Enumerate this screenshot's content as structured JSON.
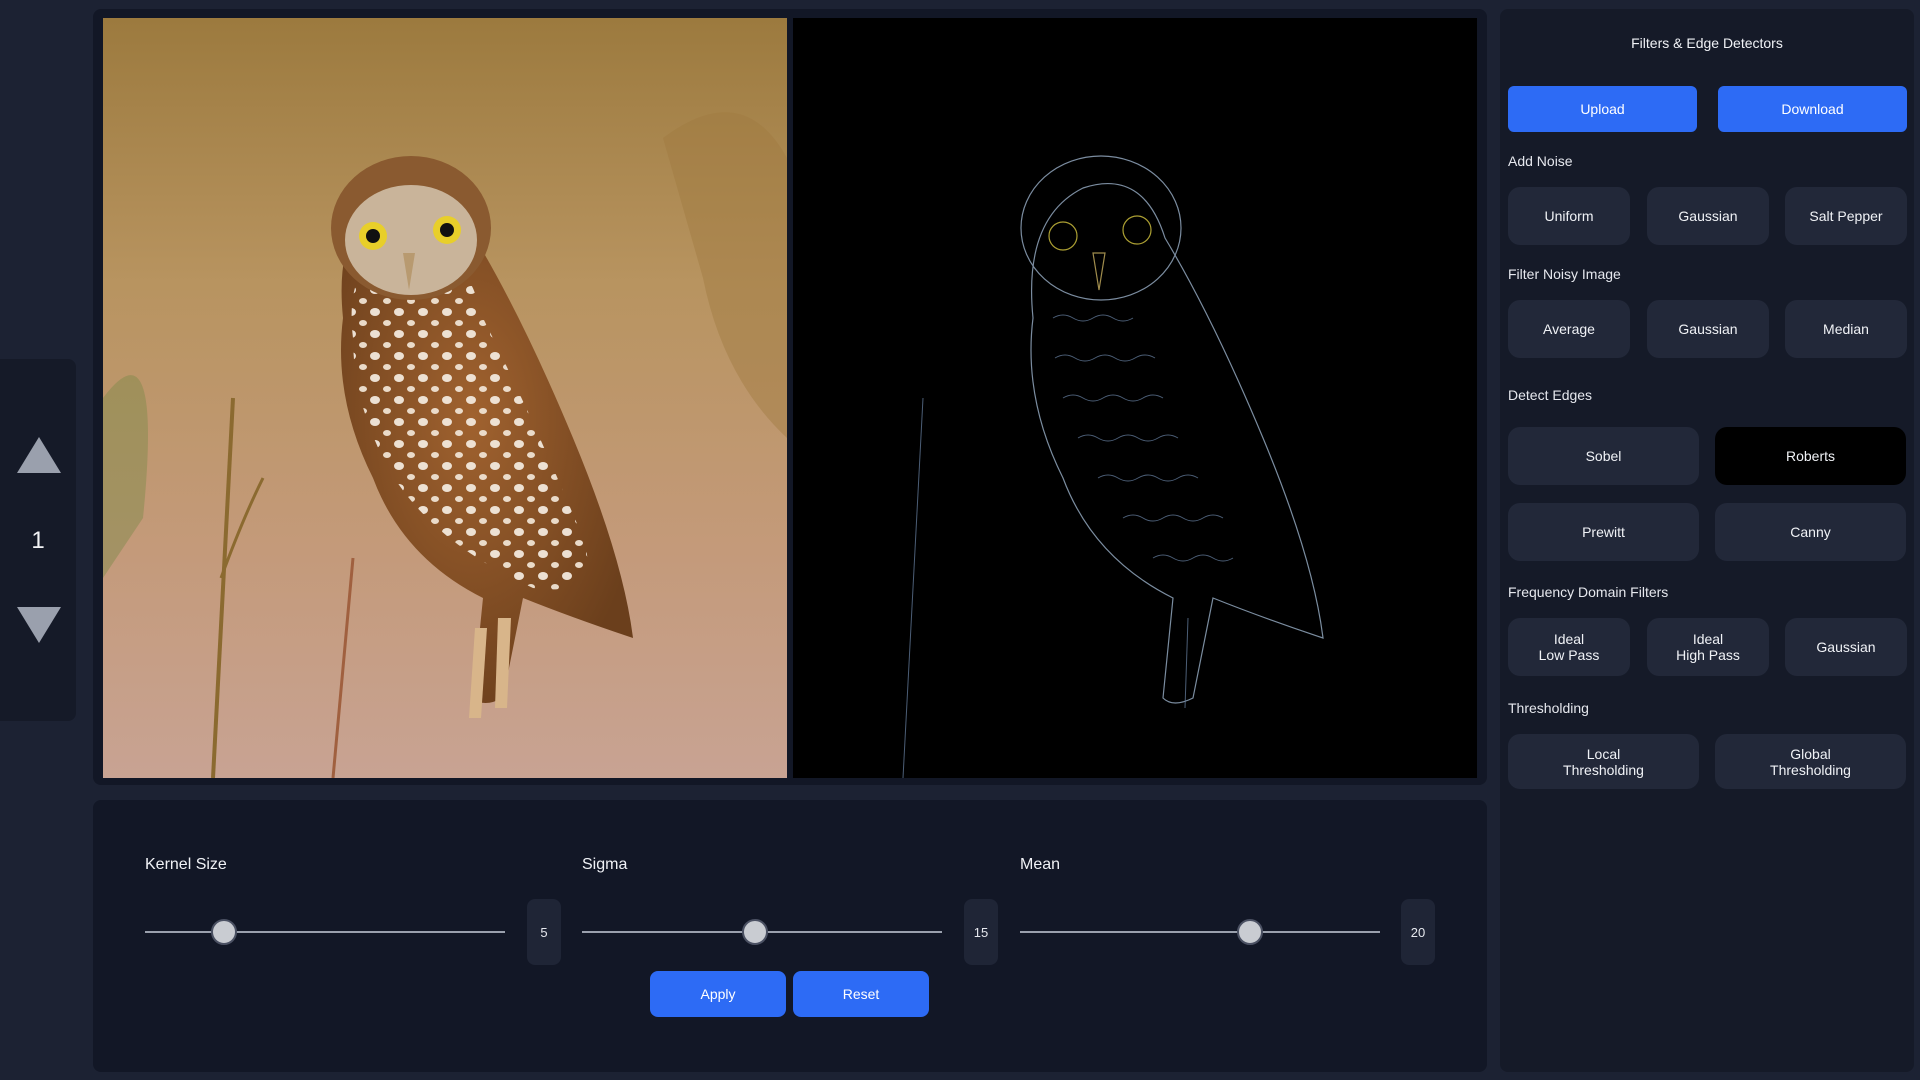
{
  "navigator": {
    "page_number": "1"
  },
  "sliders": [
    {
      "label": "Kernel Size",
      "value": "5",
      "fraction": 0.22
    },
    {
      "label": "Sigma",
      "value": "15",
      "fraction": 0.48
    },
    {
      "label": "Mean",
      "value": "20",
      "fraction": 0.64
    }
  ],
  "actions": {
    "apply_label": "Apply",
    "reset_label": "Reset"
  },
  "sidebar": {
    "title": "Filters & Edge Detectors",
    "upload_label": "Upload",
    "download_label": "Download",
    "add_noise": {
      "label": "Add Noise",
      "buttons": [
        "Uniform",
        "Gaussian",
        "Salt Pepper"
      ]
    },
    "filter_noisy": {
      "label": "Filter Noisy Image",
      "buttons": [
        "Average",
        "Gaussian",
        "Median"
      ]
    },
    "detect_edges": {
      "label": "Detect Edges",
      "buttons": [
        "Sobel",
        "Roberts",
        "Prewitt",
        "Canny"
      ],
      "active": "Roberts"
    },
    "frequency": {
      "label": "Frequency Domain Filters",
      "buttons": [
        "Ideal\nLow Pass",
        "Ideal\nHigh Pass",
        "Gaussian"
      ]
    },
    "thresholding": {
      "label": "Thresholding",
      "buttons": [
        "Local\nThresholding",
        "Global\nThresholding"
      ]
    }
  },
  "colors": {
    "accent": "#2d6bf5",
    "background": "#1c2233",
    "panel": "#121726",
    "button": "#222839",
    "active_button": "#000000"
  }
}
